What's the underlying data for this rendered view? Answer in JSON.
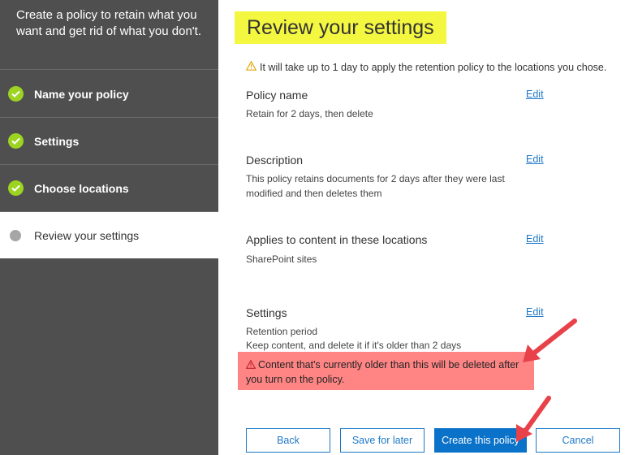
{
  "wizard": {
    "header": "Create a policy to retain what you want and get rid of what you don't.",
    "steps": [
      {
        "label": "Name your policy",
        "status": "complete"
      },
      {
        "label": "Settings",
        "status": "complete"
      },
      {
        "label": "Choose locations",
        "status": "complete"
      },
      {
        "label": "Review your settings",
        "status": "current"
      }
    ]
  },
  "main": {
    "title": "Review your settings",
    "notice": "It will take up to 1 day to apply the retention policy to the locations you chose.",
    "sections": [
      {
        "title": "Policy name",
        "value": "Retain for 2 days, then delete",
        "edit_label": "Edit"
      },
      {
        "title": "Description",
        "value": "This policy retains documents for 2 days after they were last modified and then deletes them",
        "edit_label": "Edit"
      },
      {
        "title": "Applies to content in these locations",
        "value": "SharePoint sites",
        "edit_label": "Edit"
      },
      {
        "title": "Settings",
        "value_label": "Retention period",
        "value": "Keep content, and delete it if it's older than 2 days",
        "edit_label": "Edit"
      }
    ],
    "alert": "Content that's currently older than this will be deleted after you turn on the policy."
  },
  "footer": {
    "back_label": "Back",
    "save_label": "Save for later",
    "create_label": "Create this policy",
    "cancel_label": "Cancel"
  },
  "colors": {
    "sidebar_bg": "#4f4f4f",
    "check_green": "#9dd422",
    "title_highlight": "#f4f740",
    "alert_bg": "#ff8585",
    "link_blue": "#1e78c8",
    "primary_button": "#0a72c9",
    "annotation_arrow": "#e8414a"
  }
}
